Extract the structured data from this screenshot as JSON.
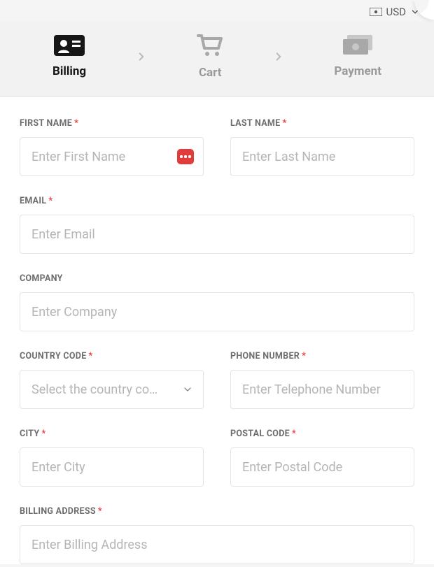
{
  "header": {
    "currency_label": "USD"
  },
  "steps": {
    "billing": "Billing",
    "cart": "Cart",
    "payment": "Payment"
  },
  "form": {
    "first_name": {
      "label": "FIRST NAME",
      "placeholder": "Enter First Name"
    },
    "last_name": {
      "label": "LAST NAME",
      "placeholder": "Enter Last Name"
    },
    "email": {
      "label": "EMAIL",
      "placeholder": "Enter Email"
    },
    "company": {
      "label": "COMPANY",
      "placeholder": "Enter Company"
    },
    "country_code": {
      "label": "COUNTRY CODE",
      "placeholder": "Select the country co…"
    },
    "phone": {
      "label": "PHONE NUMBER",
      "placeholder": "Enter Telephone Number"
    },
    "city": {
      "label": "CITY",
      "placeholder": "Enter City"
    },
    "postal": {
      "label": "POSTAL CODE",
      "placeholder": "Enter Postal Code"
    },
    "billing_address": {
      "label": "BILLING ADDRESS",
      "placeholder": "Enter Billing Address"
    }
  }
}
